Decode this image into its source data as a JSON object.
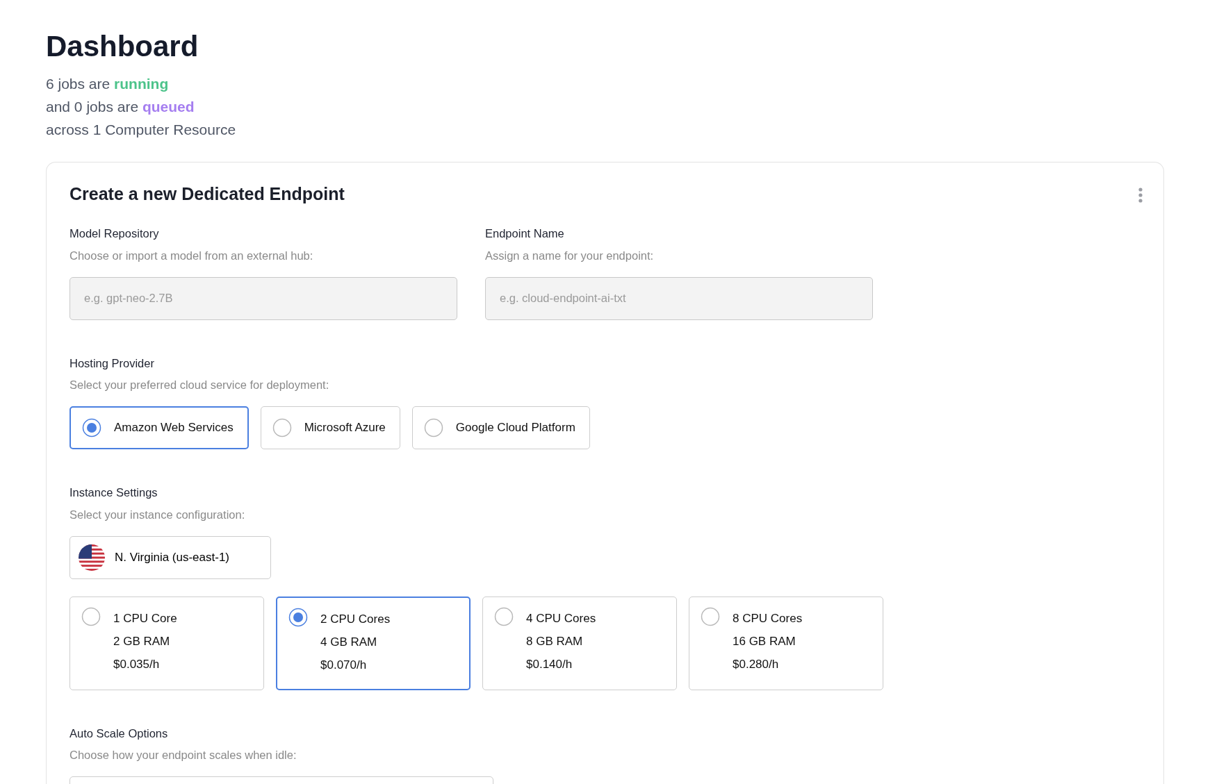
{
  "page_title": "Dashboard",
  "summary": [
    {
      "text": "6 jobs are",
      "highlight": "running",
      "color": "#4cc38a"
    },
    {
      "text": "and 0 jobs are",
      "highlight": "queued",
      "color": "#a57ef0"
    },
    {
      "text": "across 1 Computer Resource"
    }
  ],
  "card": {
    "title": "Create a new Dedicated Endpoint",
    "fields": [
      {
        "label": "Model Repository",
        "hint": "Choose or import a model from an external hub:",
        "placeholder": "e.g. gpt-neo-2.7B"
      },
      {
        "label": "Endpoint Name",
        "hint": "Assign a name for your endpoint:",
        "placeholder": "e.g. cloud-endpoint-ai-txt"
      }
    ],
    "hosting": {
      "label": "Hosting Provider",
      "hint": "Select your preferred cloud service for deployment:",
      "options": [
        {
          "label": "Amazon Web Services",
          "selected": true
        },
        {
          "label": "Microsoft Azure",
          "selected": false
        },
        {
          "label": "Google Cloud Platform",
          "selected": false
        }
      ]
    },
    "instance": {
      "label": "Instance Settings",
      "hint": "Select your instance configuration:",
      "region": "N. Virginia (us-east-1)",
      "options": [
        {
          "cpu": "1 CPU Core",
          "ram": "2 GB RAM",
          "price": "$0.035/h",
          "selected": false
        },
        {
          "cpu": "2 CPU Cores",
          "ram": "4 GB RAM",
          "price": "$0.070/h",
          "selected": true
        },
        {
          "cpu": "4 CPU Cores",
          "ram": "8 GB RAM",
          "price": "$0.140/h",
          "selected": false
        },
        {
          "cpu": "8 CPU Cores",
          "ram": "16 GB RAM",
          "price": "$0.280/h",
          "selected": false
        }
      ]
    },
    "autoscale": {
      "label": "Auto Scale Options",
      "hint": "Choose how your endpoint scales when idle:"
    }
  }
}
